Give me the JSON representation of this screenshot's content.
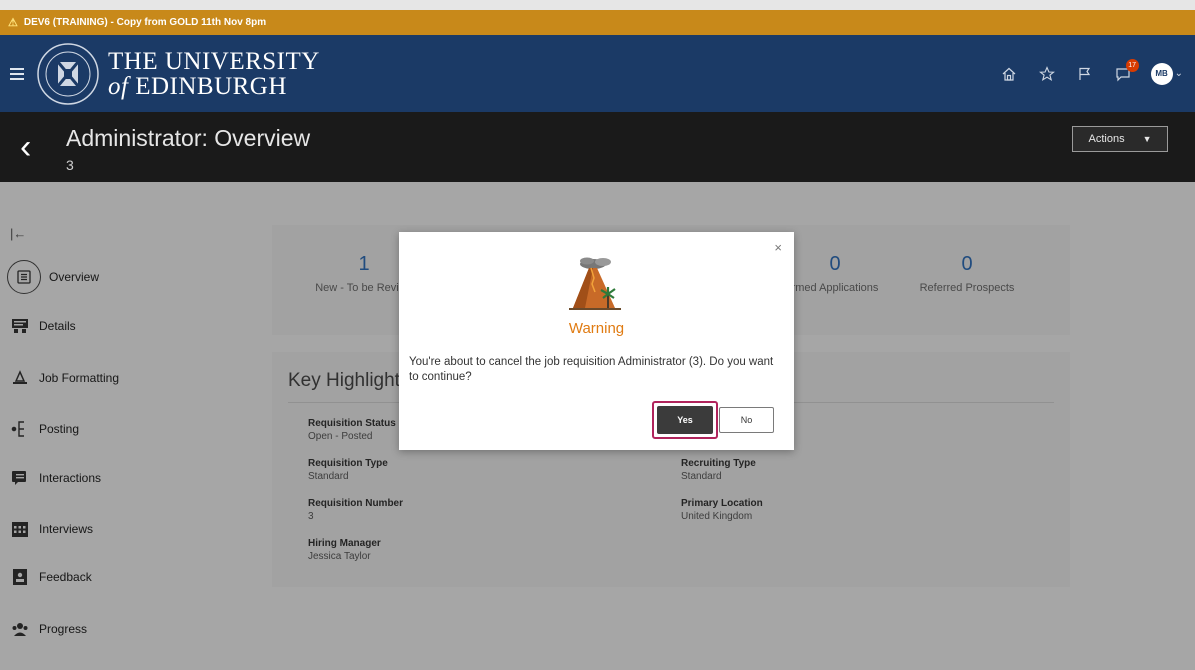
{
  "env_banner": {
    "text": "DEV6 (TRAINING) - Copy from GOLD 11th Nov 8pm"
  },
  "header": {
    "brand_line1": "THE UNIVERSITY",
    "brand_line2_prefix": "of",
    "brand_line2": "EDINBURGH",
    "notification_count": "17",
    "avatar_initials": "MB",
    "icons": [
      "home-icon",
      "star-icon",
      "flag-icon",
      "chat-icon"
    ]
  },
  "titlebar": {
    "title": "Administrator: Overview",
    "subtitle": "3",
    "actions_label": "Actions"
  },
  "nav": {
    "items": [
      {
        "label": "Overview",
        "icon": "overview-icon",
        "active": true
      },
      {
        "label": "Details",
        "icon": "details-icon"
      },
      {
        "label": "Job Formatting",
        "icon": "job-formatting-icon"
      },
      {
        "label": "Posting",
        "icon": "posting-icon"
      },
      {
        "label": "Interactions",
        "icon": "interactions-icon"
      },
      {
        "label": "Interviews",
        "icon": "interviews-icon"
      },
      {
        "label": "Feedback",
        "icon": "feedback-icon"
      },
      {
        "label": "Progress",
        "icon": "progress-icon"
      }
    ]
  },
  "metrics": [
    {
      "value": "1",
      "label": "New - To be Review"
    },
    {
      "value": "0",
      "label": "rmed Applications"
    },
    {
      "value": "0",
      "label": "Referred Prospects"
    }
  ],
  "highlights": {
    "title": "Key Highlight",
    "fields": [
      {
        "label": "Requisition Status",
        "value": "Open - Posted"
      },
      {
        "label": "Requisition Type",
        "value": "Standard"
      },
      {
        "label": "Requisition Number",
        "value": "3"
      },
      {
        "label": "Hiring Manager",
        "value": "Jessica Taylor"
      },
      {
        "label": "Recruiting Type",
        "value": "Standard"
      },
      {
        "label": "Primary Location",
        "value": "United Kingdom"
      }
    ]
  },
  "dialog": {
    "title": "Warning",
    "message": "You're about to cancel the job requisition Administrator (3). Do you want to continue?",
    "yes_label": "Yes",
    "no_label": "No",
    "close_glyph": "×"
  },
  "colors": {
    "banner": "#c8891a",
    "header": "#1b3a66",
    "titlebar": "#1a1a1a",
    "warning_title": "#e07b12",
    "highlight_frame": "#b0245c"
  }
}
